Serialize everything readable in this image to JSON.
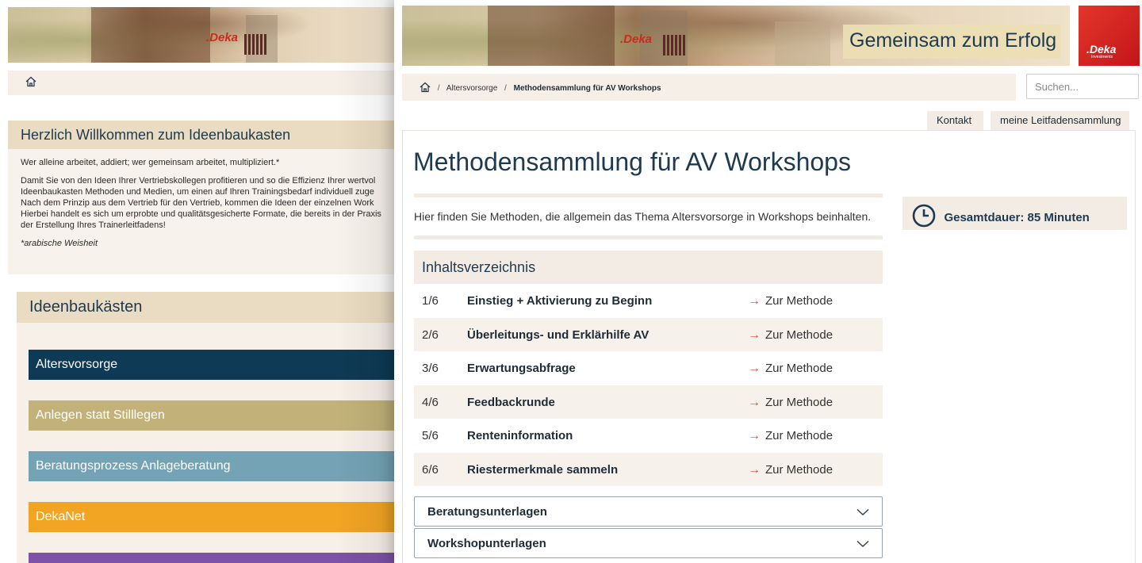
{
  "left": {
    "welcome": {
      "title": "Herzlich Willkommen zum Ideenbaukasten",
      "line1": "Wer alleine arbeitet, addiert; wer gemeinsam arbeitet, multipliziert.*",
      "para": [
        "Damit Sie von den Ideen Ihrer Vertriebskollegen profitieren und so die Effizienz Ihrer wertvol",
        "Ideenbaukasten Methoden und Medien, um einen auf Ihren Trainingsbedarf individuell zuge",
        "Nach dem Prinzip aus dem Vertrieb für den Vertrieb, kommen die Ideen der einzelnen Work",
        "Hierbei handelt es sich um erprobte und qualitätsgesicherte Formate, die bereits in der Praxis",
        "der Erstellung Ihres Trainerleitfadens!"
      ],
      "quote": "*arabische Weisheit"
    },
    "ideenbaukasten": {
      "title": "Ideenbaukästen",
      "items": [
        {
          "label": "Altersvorsorge",
          "color": "#0e3a55"
        },
        {
          "label": "Anlegen statt Stilllegen",
          "color": "#c2b27a"
        },
        {
          "label": "Beratungsprozess Anlageberatung",
          "color": "#74a3b5"
        },
        {
          "label": "DekaNet",
          "color": "#f2a423"
        },
        {
          "label": "",
          "color": "#7d52a8"
        }
      ]
    }
  },
  "right": {
    "tagline": "Gemeinsam zum Erfolg",
    "logo_text": ".Deka",
    "logo_sub": "Investments",
    "banner_mark": ".Deka",
    "breadcrumb": {
      "sep": "/",
      "parent": "Altersvorsorge",
      "current": "Methodensammlung für AV Workshops"
    },
    "search_placeholder": "Suchen...",
    "tabs": {
      "kontakt": "Kontakt",
      "leitfaden": "meine Leitfadensammlung"
    },
    "title": "Methodensammlung für AV Workshops",
    "intro": "Hier finden Sie Methoden, die allgemein das Thema Altersvorsorge in Workshops beinhalten.",
    "duration": "Gesamtdauer: 85 Minuten",
    "toc": {
      "title": "Inhaltsverzeichnis",
      "link_label": "Zur Methode",
      "rows": [
        {
          "num": "1/6",
          "title": "Einstieg + Aktivierung zu Beginn"
        },
        {
          "num": "2/6",
          "title": "Überleitungs- und Erklärhilfe AV"
        },
        {
          "num": "3/6",
          "title": "Erwartungsabfrage"
        },
        {
          "num": "4/6",
          "title": "Feedbackrunde"
        },
        {
          "num": "5/6",
          "title": "Renteninformation"
        },
        {
          "num": "6/6",
          "title": "Riestermerkmale sammeln"
        }
      ]
    },
    "accordions": [
      "Beratungsunterlagen",
      "Workshopunterlagen"
    ]
  }
}
